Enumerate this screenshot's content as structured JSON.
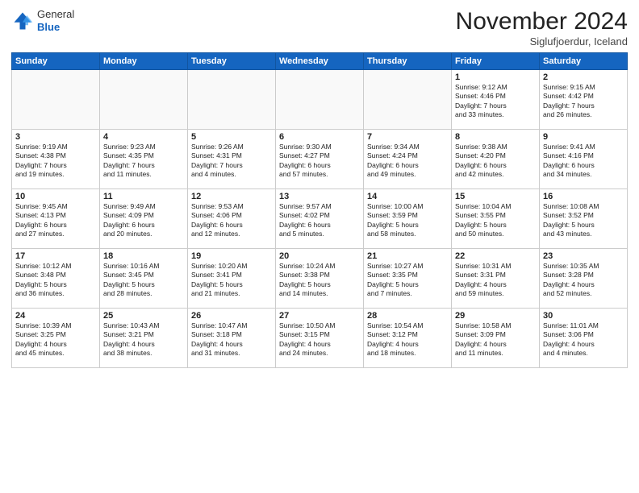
{
  "header": {
    "logo_line1": "General",
    "logo_line2": "Blue",
    "month": "November 2024",
    "location": "Siglufjoerdur, Iceland"
  },
  "weekdays": [
    "Sunday",
    "Monday",
    "Tuesday",
    "Wednesday",
    "Thursday",
    "Friday",
    "Saturday"
  ],
  "weeks": [
    [
      {
        "day": "",
        "info": ""
      },
      {
        "day": "",
        "info": ""
      },
      {
        "day": "",
        "info": ""
      },
      {
        "day": "",
        "info": ""
      },
      {
        "day": "",
        "info": ""
      },
      {
        "day": "1",
        "info": "Sunrise: 9:12 AM\nSunset: 4:46 PM\nDaylight: 7 hours\nand 33 minutes."
      },
      {
        "day": "2",
        "info": "Sunrise: 9:15 AM\nSunset: 4:42 PM\nDaylight: 7 hours\nand 26 minutes."
      }
    ],
    [
      {
        "day": "3",
        "info": "Sunrise: 9:19 AM\nSunset: 4:38 PM\nDaylight: 7 hours\nand 19 minutes."
      },
      {
        "day": "4",
        "info": "Sunrise: 9:23 AM\nSunset: 4:35 PM\nDaylight: 7 hours\nand 11 minutes."
      },
      {
        "day": "5",
        "info": "Sunrise: 9:26 AM\nSunset: 4:31 PM\nDaylight: 7 hours\nand 4 minutes."
      },
      {
        "day": "6",
        "info": "Sunrise: 9:30 AM\nSunset: 4:27 PM\nDaylight: 6 hours\nand 57 minutes."
      },
      {
        "day": "7",
        "info": "Sunrise: 9:34 AM\nSunset: 4:24 PM\nDaylight: 6 hours\nand 49 minutes."
      },
      {
        "day": "8",
        "info": "Sunrise: 9:38 AM\nSunset: 4:20 PM\nDaylight: 6 hours\nand 42 minutes."
      },
      {
        "day": "9",
        "info": "Sunrise: 9:41 AM\nSunset: 4:16 PM\nDaylight: 6 hours\nand 34 minutes."
      }
    ],
    [
      {
        "day": "10",
        "info": "Sunrise: 9:45 AM\nSunset: 4:13 PM\nDaylight: 6 hours\nand 27 minutes."
      },
      {
        "day": "11",
        "info": "Sunrise: 9:49 AM\nSunset: 4:09 PM\nDaylight: 6 hours\nand 20 minutes."
      },
      {
        "day": "12",
        "info": "Sunrise: 9:53 AM\nSunset: 4:06 PM\nDaylight: 6 hours\nand 12 minutes."
      },
      {
        "day": "13",
        "info": "Sunrise: 9:57 AM\nSunset: 4:02 PM\nDaylight: 6 hours\nand 5 minutes."
      },
      {
        "day": "14",
        "info": "Sunrise: 10:00 AM\nSunset: 3:59 PM\nDaylight: 5 hours\nand 58 minutes."
      },
      {
        "day": "15",
        "info": "Sunrise: 10:04 AM\nSunset: 3:55 PM\nDaylight: 5 hours\nand 50 minutes."
      },
      {
        "day": "16",
        "info": "Sunrise: 10:08 AM\nSunset: 3:52 PM\nDaylight: 5 hours\nand 43 minutes."
      }
    ],
    [
      {
        "day": "17",
        "info": "Sunrise: 10:12 AM\nSunset: 3:48 PM\nDaylight: 5 hours\nand 36 minutes."
      },
      {
        "day": "18",
        "info": "Sunrise: 10:16 AM\nSunset: 3:45 PM\nDaylight: 5 hours\nand 28 minutes."
      },
      {
        "day": "19",
        "info": "Sunrise: 10:20 AM\nSunset: 3:41 PM\nDaylight: 5 hours\nand 21 minutes."
      },
      {
        "day": "20",
        "info": "Sunrise: 10:24 AM\nSunset: 3:38 PM\nDaylight: 5 hours\nand 14 minutes."
      },
      {
        "day": "21",
        "info": "Sunrise: 10:27 AM\nSunset: 3:35 PM\nDaylight: 5 hours\nand 7 minutes."
      },
      {
        "day": "22",
        "info": "Sunrise: 10:31 AM\nSunset: 3:31 PM\nDaylight: 4 hours\nand 59 minutes."
      },
      {
        "day": "23",
        "info": "Sunrise: 10:35 AM\nSunset: 3:28 PM\nDaylight: 4 hours\nand 52 minutes."
      }
    ],
    [
      {
        "day": "24",
        "info": "Sunrise: 10:39 AM\nSunset: 3:25 PM\nDaylight: 4 hours\nand 45 minutes."
      },
      {
        "day": "25",
        "info": "Sunrise: 10:43 AM\nSunset: 3:21 PM\nDaylight: 4 hours\nand 38 minutes."
      },
      {
        "day": "26",
        "info": "Sunrise: 10:47 AM\nSunset: 3:18 PM\nDaylight: 4 hours\nand 31 minutes."
      },
      {
        "day": "27",
        "info": "Sunrise: 10:50 AM\nSunset: 3:15 PM\nDaylight: 4 hours\nand 24 minutes."
      },
      {
        "day": "28",
        "info": "Sunrise: 10:54 AM\nSunset: 3:12 PM\nDaylight: 4 hours\nand 18 minutes."
      },
      {
        "day": "29",
        "info": "Sunrise: 10:58 AM\nSunset: 3:09 PM\nDaylight: 4 hours\nand 11 minutes."
      },
      {
        "day": "30",
        "info": "Sunrise: 11:01 AM\nSunset: 3:06 PM\nDaylight: 4 hours\nand 4 minutes."
      }
    ]
  ]
}
